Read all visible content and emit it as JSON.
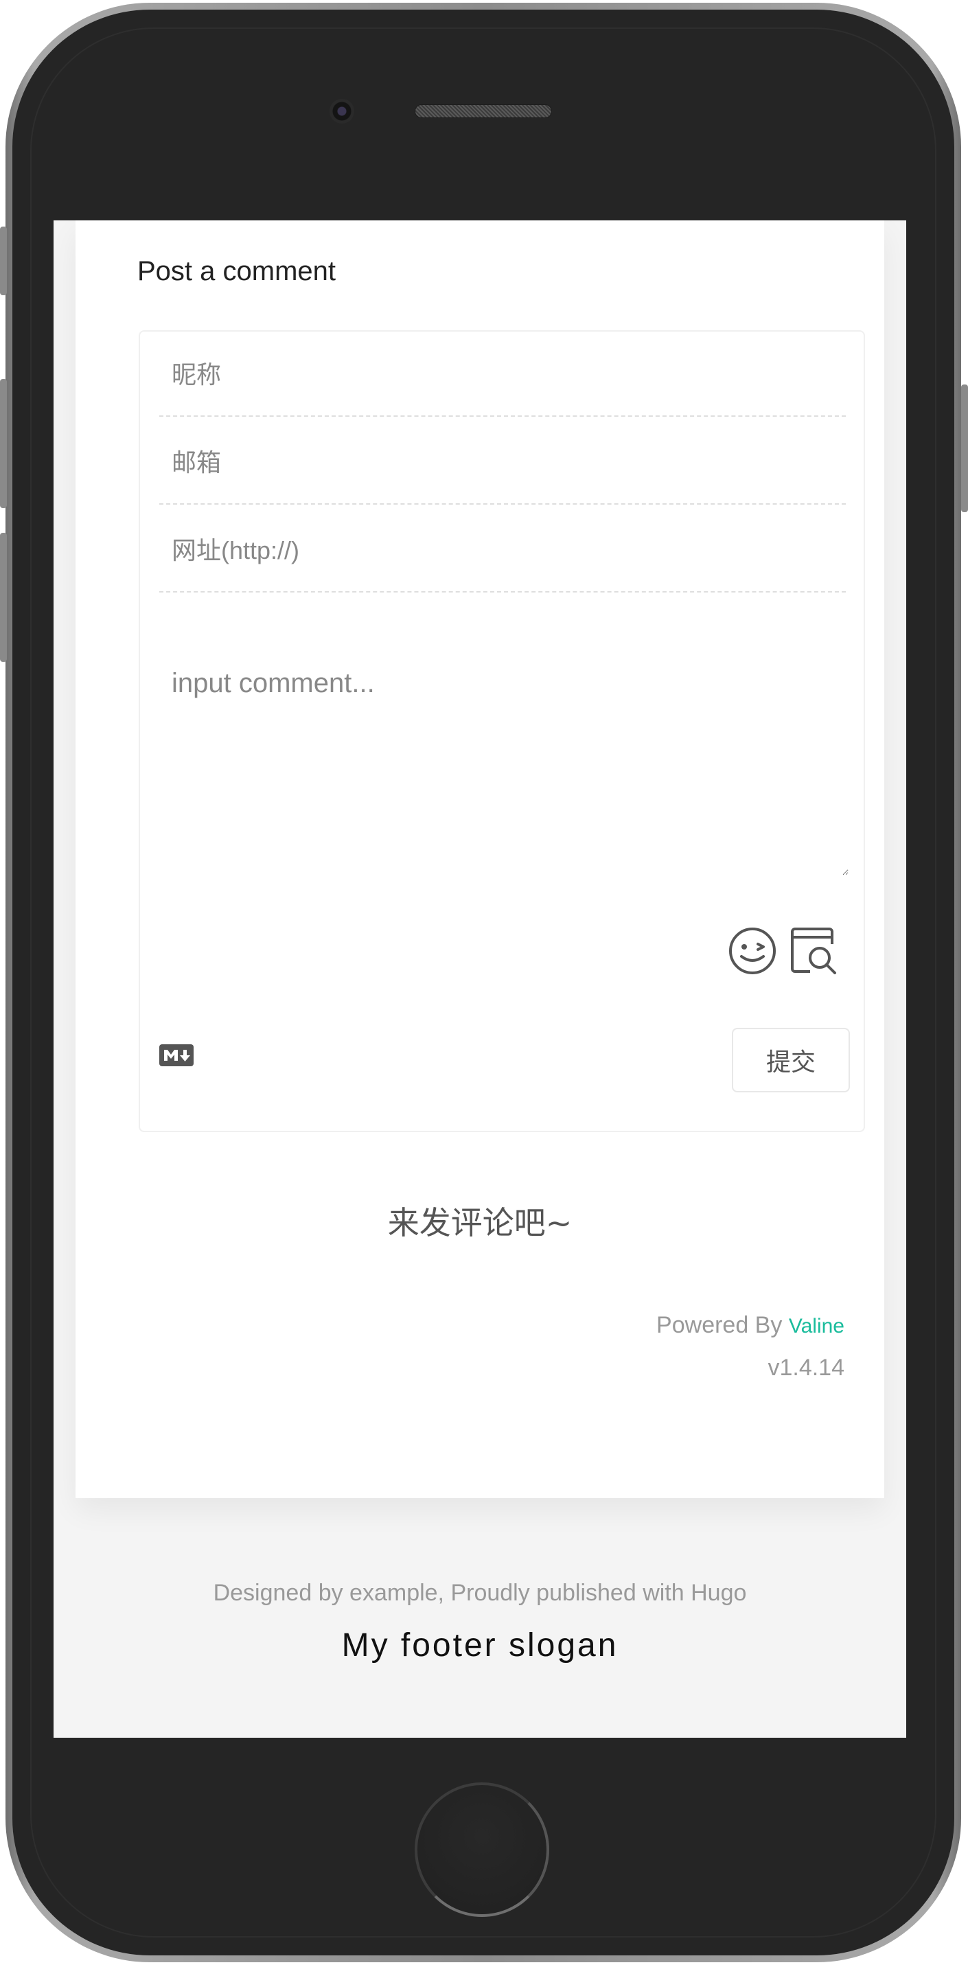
{
  "comment_form": {
    "heading": "Post a comment",
    "nickname_placeholder": "昵称",
    "email_placeholder": "邮箱",
    "website_placeholder": "网址(http://)",
    "comment_placeholder": "input comment...",
    "emoji_icon": "emoji-wink-icon",
    "preview_icon": "preview-search-icon",
    "markdown_icon": "markdown-icon",
    "submit_label": "提交"
  },
  "comments": {
    "empty_text": "来发评论吧~",
    "powered_by_prefix": "Powered By",
    "powered_by_link": "Valine",
    "version": "v1.4.14"
  },
  "footer": {
    "credit": "Designed by example, Proudly published with Hugo",
    "slogan": "My footer slogan"
  },
  "colors": {
    "accent": "#1abc9c",
    "text": "#555555",
    "muted": "#999999"
  }
}
